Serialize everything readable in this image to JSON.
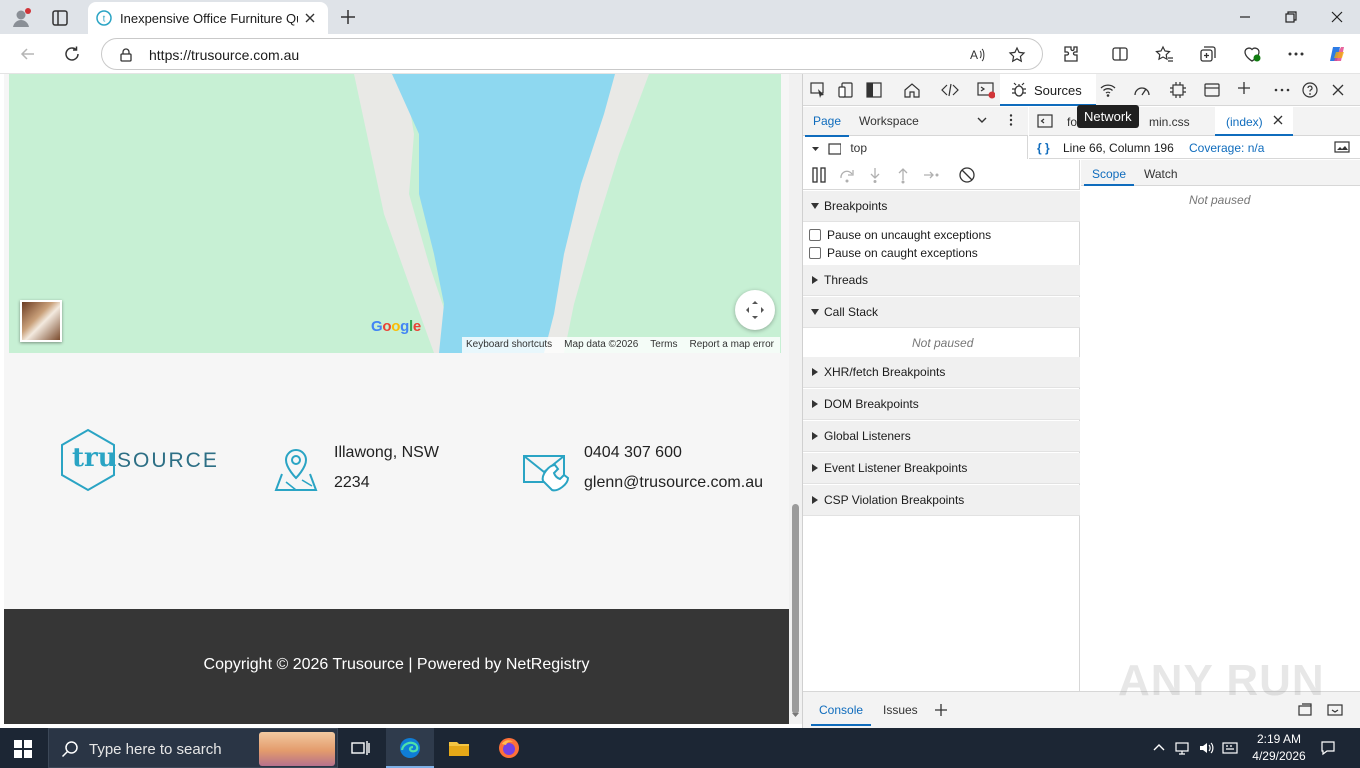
{
  "browser": {
    "tab_title": "Inexpensive Office Furniture Quot",
    "url": "https://trusource.com.au"
  },
  "map": {
    "google_letters": [
      "G",
      "o",
      "o",
      "g",
      "l",
      "e"
    ],
    "google_colors": [
      "#4285f4",
      "#ea4335",
      "#fbbc05",
      "#4285f4",
      "#34a853",
      "#ea4335"
    ],
    "attribution": {
      "shortcuts": "Keyboard shortcuts",
      "data": "Map data ©2026",
      "terms": "Terms",
      "report": "Report a map error"
    }
  },
  "site": {
    "logo_tru": "tru",
    "logo_source": "SOURCE",
    "address_line1": "Illawong, NSW",
    "address_line2": "2234",
    "phone": "0404 307 600",
    "email": "glenn@trusource.com.au",
    "copyright": "Copyright © 2026 Trusource | Powered by NetRegistry",
    "accent_color": "#2aa4c4"
  },
  "devtools": {
    "active_panel": "Sources",
    "tooltip": "Network",
    "navigator_tabs": [
      "Page",
      "Workspace"
    ],
    "tree_root": "top",
    "editor_tabs": {
      "first": "fo",
      "second": "min.css",
      "third": "(index)"
    },
    "status": {
      "position": "Line 66, Column 196",
      "coverage": "Coverage: n/a"
    },
    "sections": {
      "breakpoints": "Breakpoints",
      "pause_uncaught": "Pause on uncaught exceptions",
      "pause_caught": "Pause on caught exceptions",
      "threads": "Threads",
      "call_stack": "Call Stack",
      "not_paused": "Not paused",
      "xhr": "XHR/fetch Breakpoints",
      "dom": "DOM Breakpoints",
      "global": "Global Listeners",
      "event": "Event Listener Breakpoints",
      "csp": "CSP Violation Breakpoints"
    },
    "scope_tabs": [
      "Scope",
      "Watch"
    ],
    "scope_not_paused": "Not paused",
    "drawer_tabs": [
      "Console",
      "Issues"
    ]
  },
  "watermark": "ANY RUN",
  "taskbar": {
    "search_placeholder": "Type here to search",
    "time": "2:19 AM",
    "date": "4/29/2026"
  }
}
